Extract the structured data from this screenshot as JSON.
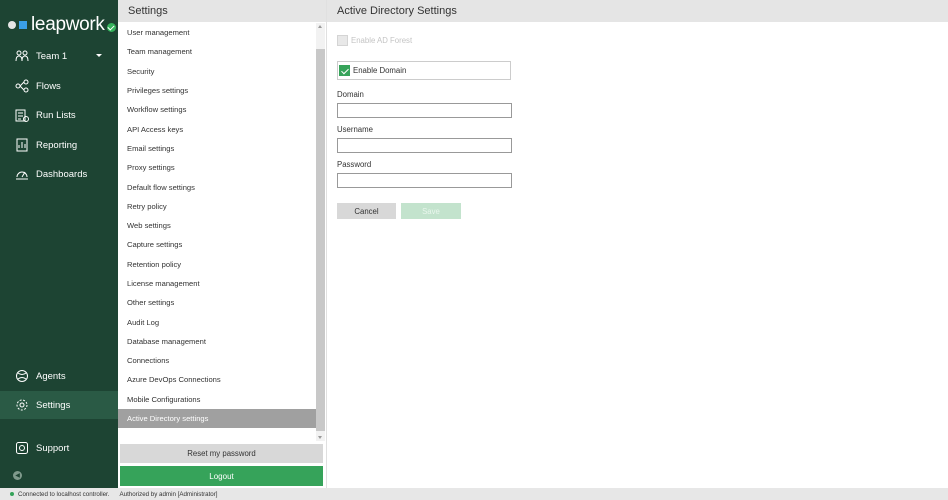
{
  "app": {
    "logo_text": "leapwork"
  },
  "nav": {
    "team": "Team 1",
    "items": [
      {
        "label": "Flows",
        "icon": "flows-icon"
      },
      {
        "label": "Run Lists",
        "icon": "run-lists-icon"
      },
      {
        "label": "Reporting",
        "icon": "reporting-icon"
      },
      {
        "label": "Dashboards",
        "icon": "dashboards-icon"
      }
    ],
    "bottom": [
      {
        "label": "Agents",
        "icon": "agents-icon"
      },
      {
        "label": "Settings",
        "icon": "gear-icon"
      },
      {
        "label": "Support",
        "icon": "support-icon"
      }
    ]
  },
  "settings_panel": {
    "title": "Settings",
    "items": [
      "User management",
      "Team management",
      "Security",
      "Privileges settings",
      "Workflow settings",
      "API Access keys",
      "Email settings",
      "Proxy settings",
      "Default flow settings",
      "Retry policy",
      "Web settings",
      "Capture settings",
      "Retention policy",
      "License management",
      "Other settings",
      "Audit Log",
      "Database management",
      "Connections",
      "Azure DevOps Connections",
      "Mobile Configurations",
      "Active Directory settings"
    ],
    "selected": "Active Directory settings",
    "reset_label": "Reset my password",
    "logout_label": "Logout"
  },
  "main": {
    "title": "Active Directory Settings",
    "enable_forest_label": "Enable AD Forest",
    "enable_domain_label": "Enable Domain",
    "enable_domain_checked": true,
    "domain_label": "Domain",
    "domain_value": "",
    "username_label": "Username",
    "username_value": "",
    "password_label": "Password",
    "password_value": "",
    "cancel_label": "Cancel",
    "save_label": "Save"
  },
  "status": {
    "connection": "Connected to localhost controller.",
    "authorized": "Authorized by  admin [Administrator]"
  },
  "colors": {
    "nav_bg": "#1d4433",
    "accent_green": "#36a35a",
    "selected_item": "#a0a0a0"
  }
}
